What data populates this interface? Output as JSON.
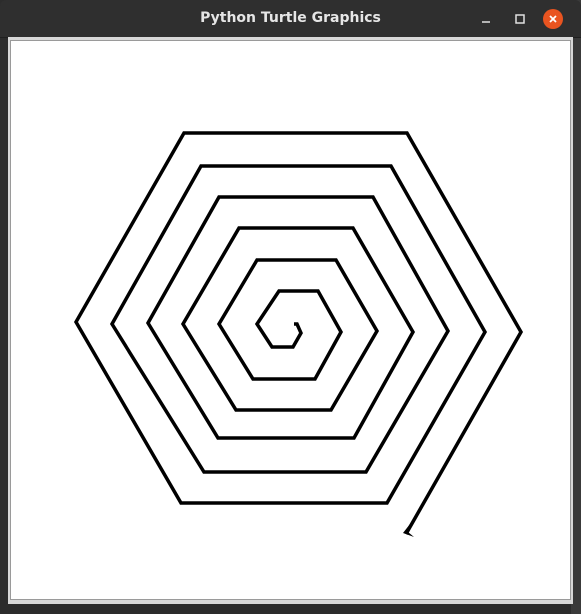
{
  "window": {
    "title": "Python Turtle Graphics"
  },
  "turtle": {
    "shape": "arrow",
    "pen_color": "#000000",
    "pen_width": 3
  },
  "colors": {
    "titlebar": "#2f2f2f",
    "close_button": "#e95420",
    "canvas": "#ffffff"
  }
}
